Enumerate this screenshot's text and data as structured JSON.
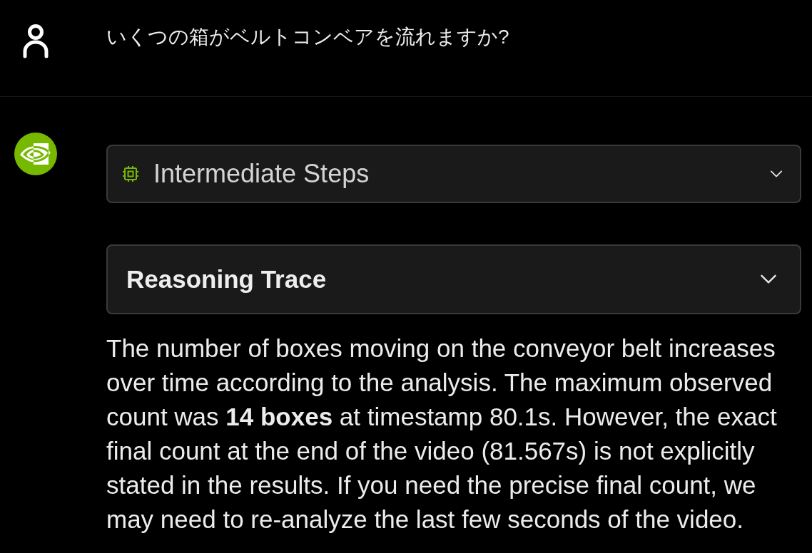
{
  "user_message": {
    "text": "いくつの箱がベルトコンベアを流れますか?"
  },
  "assistant_message": {
    "panels": [
      {
        "kind": "steps",
        "title": "Intermediate Steps",
        "expanded": false
      },
      {
        "kind": "trace",
        "title": "Reasoning Trace",
        "expanded": false
      }
    ],
    "answer": "The number of boxes moving on the conveyor belt increases over time according to the analysis. The maximum observed count was **14 boxes** at timestamp 80.1s. However, the exact final count at the end of the video (81.567s) is not explicitly stated in the results. If you need the precise final count, we may need to re-analyze the last few seconds of the video."
  }
}
